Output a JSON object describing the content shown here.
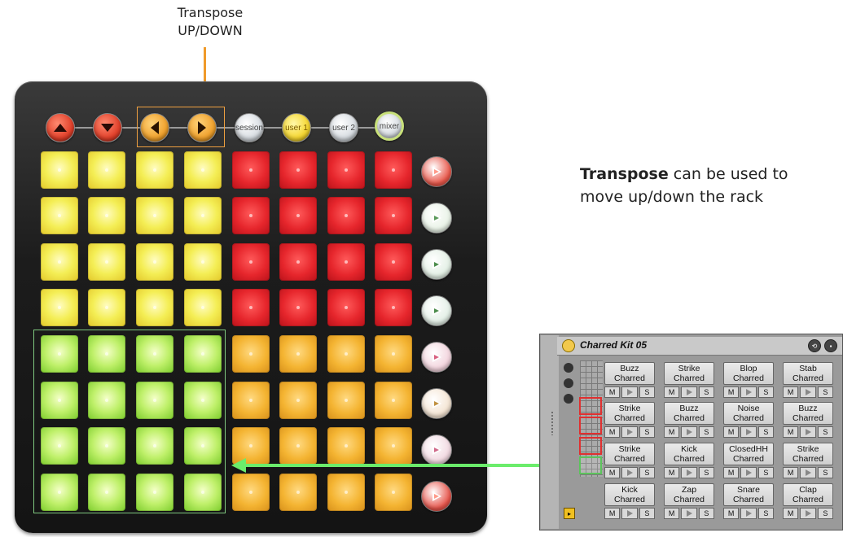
{
  "callouts": {
    "transpose_top_line1": "Transpose",
    "transpose_top_line2": "UP/DOWN",
    "transpose_right_bold": "Transpose",
    "transpose_right_rest": " can be used to",
    "transpose_right_line2": "move up/down the rack"
  },
  "launchpad": {
    "top_buttons": {
      "up": {
        "icon": "arrow-up-icon"
      },
      "down": {
        "icon": "arrow-down-icon"
      },
      "left": {
        "icon": "arrow-left-icon"
      },
      "right": {
        "icon": "arrow-right-icon"
      },
      "session": "session",
      "user1": "user 1",
      "user2": "user 2",
      "mixer": "mixer"
    },
    "pad_rows": [
      [
        "yellow",
        "yellow",
        "yellow",
        "yellow",
        "red",
        "red",
        "red",
        "red"
      ],
      [
        "yellow",
        "yellow",
        "yellow",
        "yellow",
        "red",
        "red",
        "red",
        "red"
      ],
      [
        "yellow",
        "yellow",
        "yellow",
        "yellow",
        "red",
        "red",
        "red",
        "red"
      ],
      [
        "yellow",
        "yellow",
        "yellow",
        "yellow",
        "red",
        "red",
        "red",
        "red"
      ],
      [
        "green",
        "green",
        "green",
        "green",
        "amber",
        "amber",
        "amber",
        "amber"
      ],
      [
        "green",
        "green",
        "green",
        "green",
        "amber",
        "amber",
        "amber",
        "amber"
      ],
      [
        "green",
        "green",
        "green",
        "green",
        "amber",
        "amber",
        "amber",
        "amber"
      ],
      [
        "green",
        "green",
        "green",
        "green",
        "amber",
        "amber",
        "amber",
        "amber"
      ]
    ],
    "scene_buttons": [
      "#e8574a",
      "#e8f2e6",
      "#e2efe4",
      "#e3efe6",
      "#f2d3dc",
      "#f4e4d2",
      "#f1d8e0",
      "#e6544a"
    ],
    "scene_tri_colors": [
      "#ff9b8a",
      "#5a9a5a",
      "#4b8c4b",
      "#4b8c4b",
      "#d86080",
      "#c09040",
      "#d06a8a",
      "#ff9b8a"
    ]
  },
  "rack": {
    "title": "Charred Kit 05",
    "cells": [
      [
        "Buzz\nCharred",
        "Strike\nCharred",
        "Blop\nCharred",
        "Stab\nCharred"
      ],
      [
        "Strike\nCharred",
        "Buzz\nCharred",
        "Noise\nCharred",
        "Buzz\nCharred"
      ],
      [
        "Strike\nCharred",
        "Kick\nCharred",
        "ClosedHH\nCharred",
        "Strike\nCharred"
      ],
      [
        "Kick\nCharred",
        "Zap\nCharred",
        "Snare\nCharred",
        "Clap\nCharred"
      ]
    ],
    "mute_label": "M",
    "solo_label": "S"
  },
  "colors": {
    "orange_annotation": "#f09a2a",
    "green_annotation": "#6bec6b"
  }
}
